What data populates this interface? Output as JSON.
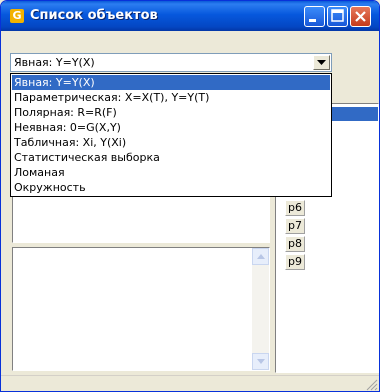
{
  "window": {
    "title": "Список объектов",
    "icon_letter": "G"
  },
  "combo": {
    "selected": "Явная: Y=Y(X)"
  },
  "dropdown_options": [
    "Явная: Y=Y(X)",
    "Параметрическая: X=X(T), Y=Y(T)",
    "Полярная: R=R(F)",
    "Неявная: 0=G(X,Y)",
    "Табличная: Xi, Y(Xi)",
    "Статистическая выборка",
    "Ломаная",
    "Окружность"
  ],
  "object_list": [
    "p6",
    "p7",
    "p8",
    "p9"
  ],
  "colors": {
    "titlebar": "#0658dd",
    "selection": "#316ac5",
    "close_button": "#c53b1c",
    "window_bg": "#ece9d8"
  }
}
